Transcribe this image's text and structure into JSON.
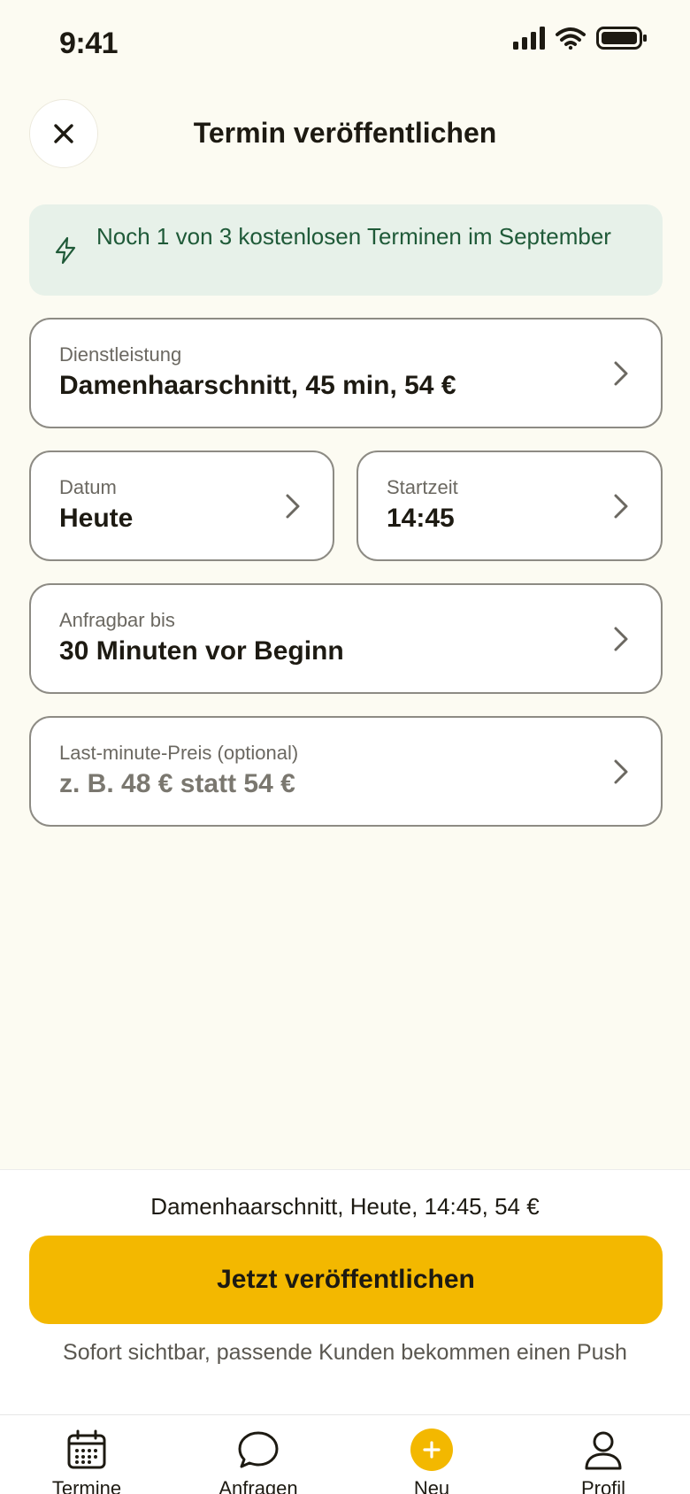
{
  "status_bar": {
    "time": "9:41"
  },
  "header": {
    "title": "Termin veröffentlichen"
  },
  "notice": {
    "text": "Noch 1 von 3 kostenlosen Terminen im September"
  },
  "fields": {
    "service": {
      "label": "Dienstleistung",
      "value": "Damenhaarschnitt, 45 min, 54 €"
    },
    "date": {
      "label": "Datum",
      "value": "Heute"
    },
    "start_time": {
      "label": "Startzeit",
      "value": "14:45"
    },
    "bookable_until": {
      "label": "Anfragbar bis",
      "value": "30 Minuten vor Beginn"
    },
    "last_minute_price": {
      "label": "Last-minute-Preis (optional)",
      "placeholder": "z. B. 48 € statt 54 €"
    }
  },
  "footer": {
    "summary": "Damenhaarschnitt, Heute, 14:45, 54 €",
    "publish_label": "Jetzt veröffentlichen",
    "hint": "Sofort sichtbar, passende Kunden bekommen einen Push"
  },
  "tabs": [
    {
      "label": "Termine",
      "icon": "calendar-icon"
    },
    {
      "label": "Anfragen",
      "icon": "chat-bubble-icon"
    },
    {
      "label": "Neu",
      "icon": "plus-icon"
    },
    {
      "label": "Profil",
      "icon": "person-icon"
    }
  ],
  "colors": {
    "background": "#fcfbf2",
    "accent": "#f3b800",
    "notice_bg": "#e7f1e9",
    "notice_text": "#1f5a38",
    "text": "#1d1a12"
  }
}
